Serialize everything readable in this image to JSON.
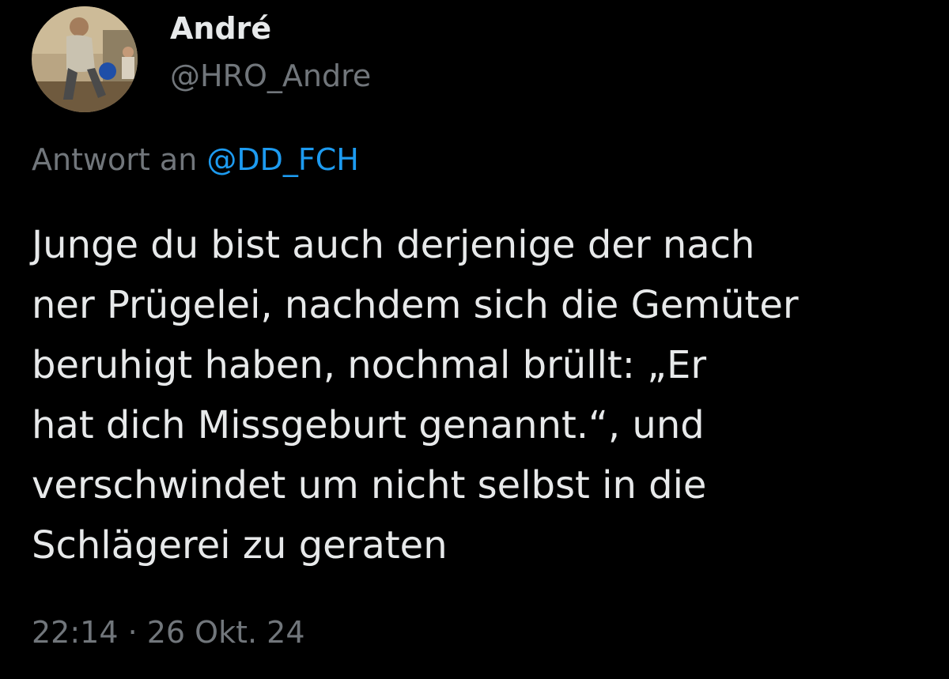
{
  "author": {
    "display_name": "André",
    "handle": "@HRO_Andre",
    "avatar_icon": "profile-photo-bowling"
  },
  "reply": {
    "prefix": "Antwort an",
    "target": "@DD_FCH"
  },
  "tweet": {
    "lines": [
      "Junge du bist auch derjenige der nach",
      "ner Prügelei, nachdem sich die Gemüter",
      "beruhigt haben, nochmal brüllt: „Er",
      "hat dich Missgeburt genannt.“, und",
      "verschwindet um nicht selbst in die",
      "Schlägerei zu geraten"
    ]
  },
  "meta": {
    "timestamp": "22:14 · 26 Okt. 24"
  },
  "colors": {
    "background": "#000000",
    "text_primary": "#e7e9ea",
    "text_secondary": "#71767b",
    "link": "#1d9bf0"
  }
}
